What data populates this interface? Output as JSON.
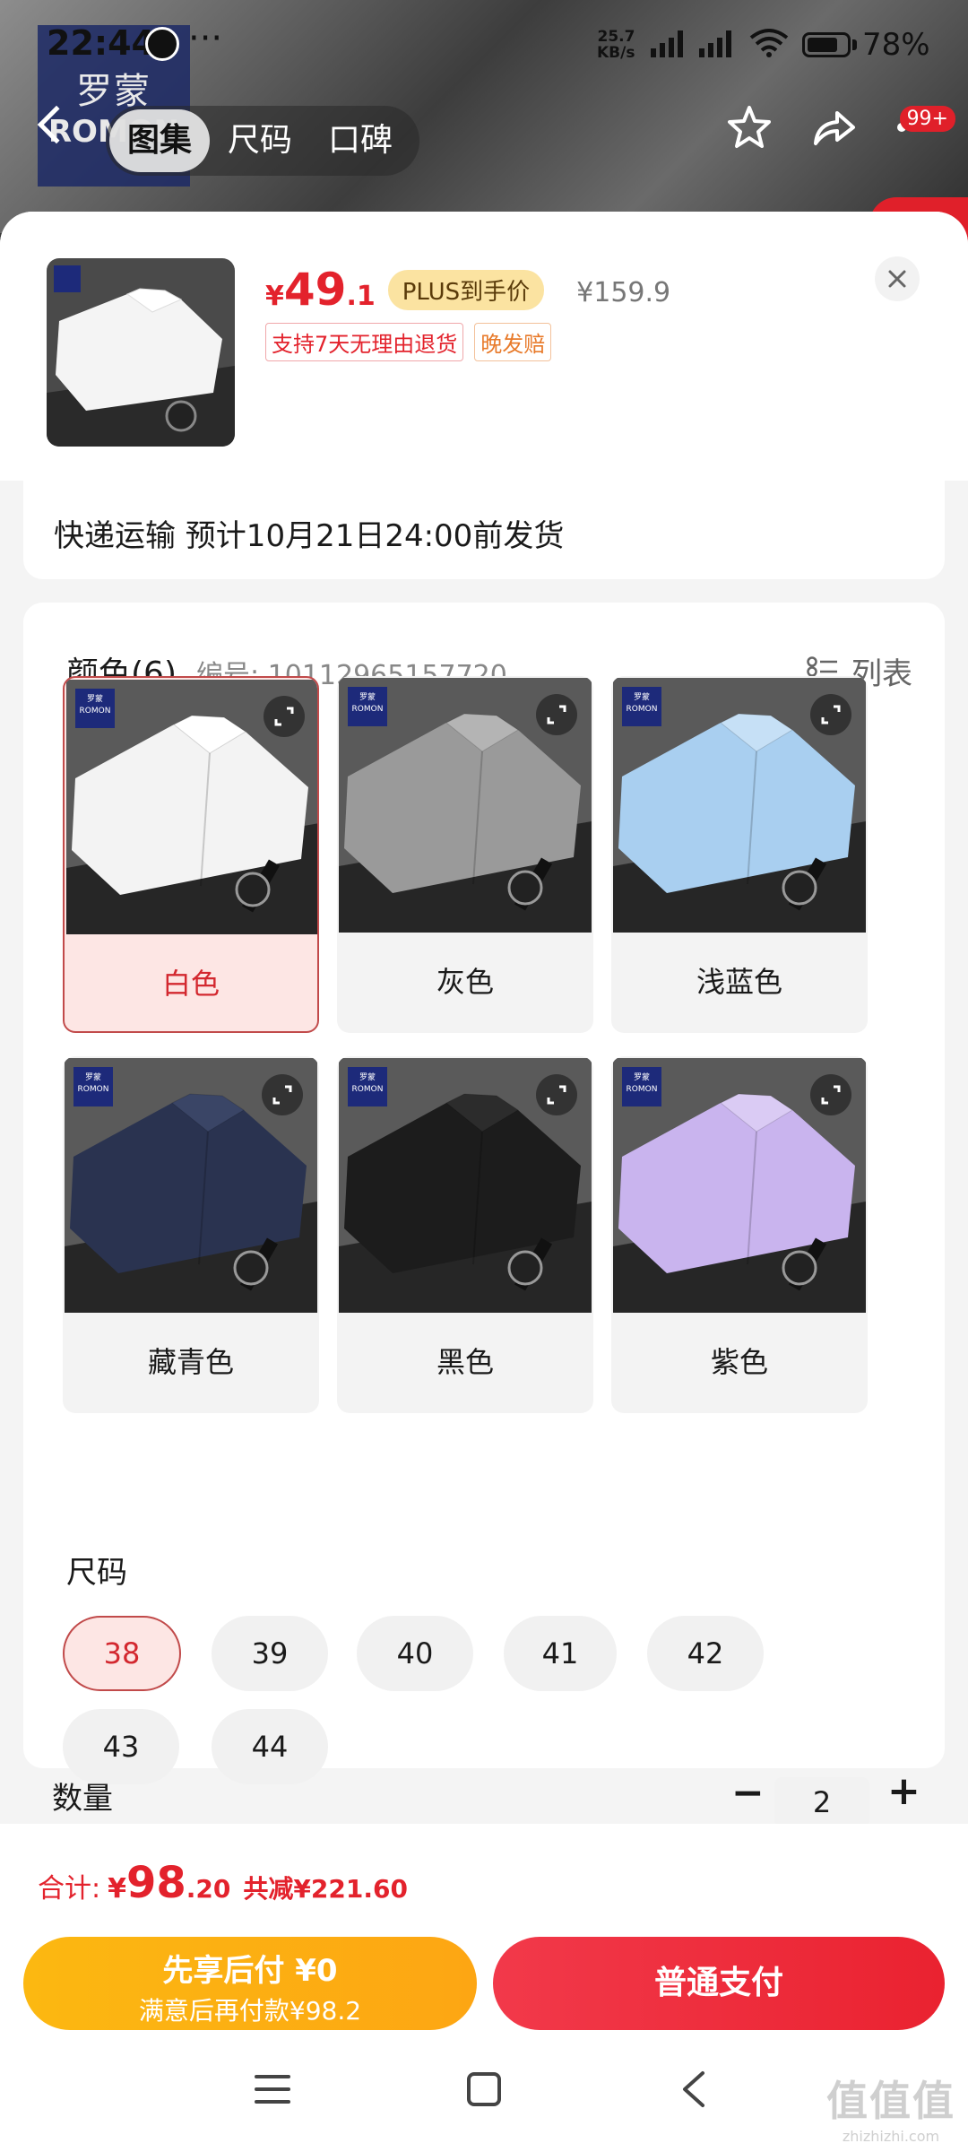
{
  "status_bar": {
    "time": "22:44",
    "dots": "···",
    "net_speed_value": "25.7",
    "net_speed_unit": "KB/s",
    "battery": "78%"
  },
  "top_nav": {
    "tabs": [
      {
        "label": "图集",
        "active": true
      },
      {
        "label": "尺码",
        "active": false
      },
      {
        "label": "口碑",
        "active": false
      }
    ],
    "cart_badge": "99+",
    "background_brand_cn": "罗蒙",
    "background_brand_en": "ROMON"
  },
  "product": {
    "price_symbol": "¥",
    "price_int": "49",
    "price_dec": ".1",
    "plus_label": "PLUS到手价",
    "original_price": "¥159.9",
    "tags": [
      "支持7天无理由退货",
      "晚发赔"
    ],
    "shipping": "快递运输 预计10月21日24:00前发货"
  },
  "color_section": {
    "title": "颜色(6)",
    "code": "编号: 10112965157720",
    "list_label": "列表",
    "options": [
      {
        "label": "白色",
        "shirt": "#f3f3f3",
        "collar": "#ffffff",
        "selected": true
      },
      {
        "label": "灰色",
        "shirt": "#9a9a9a",
        "collar": "#b4b4b4",
        "selected": false
      },
      {
        "label": "浅蓝色",
        "shirt": "#a9cff0",
        "collar": "#c6e0f6",
        "selected": false
      },
      {
        "label": "藏青色",
        "shirt": "#2a3350",
        "collar": "#3a4566",
        "selected": false
      },
      {
        "label": "黑色",
        "shirt": "#1c1c1c",
        "collar": "#2c2c2c",
        "selected": false
      },
      {
        "label": "紫色",
        "shirt": "#c9b4ee",
        "collar": "#dacbf4",
        "selected": false
      }
    ],
    "brand_cn": "罗蒙",
    "brand_en": "ROMON"
  },
  "size_section": {
    "title": "尺码",
    "options": [
      "38",
      "39",
      "40",
      "41",
      "42",
      "43",
      "44"
    ],
    "selected": "38"
  },
  "quantity": {
    "title": "数量",
    "minus": "−",
    "value": "2",
    "plus": "+"
  },
  "summary": {
    "label": "合计:",
    "symbol": "¥",
    "total_int": "98",
    "total_dec": ".20",
    "savings": "共减¥221.60"
  },
  "actions": {
    "pay_later_line1": "先享后付 ¥0",
    "pay_later_line2": "满意后再付款¥98.2",
    "pay_normal": "普通支付"
  },
  "watermark": {
    "big": "值值值",
    "small": "zhizhizhi.com"
  },
  "colors": {
    "accent_red": "#e3222c",
    "pay_later_yellow": "#fdb011",
    "selected_bg": "#fde6e4"
  }
}
